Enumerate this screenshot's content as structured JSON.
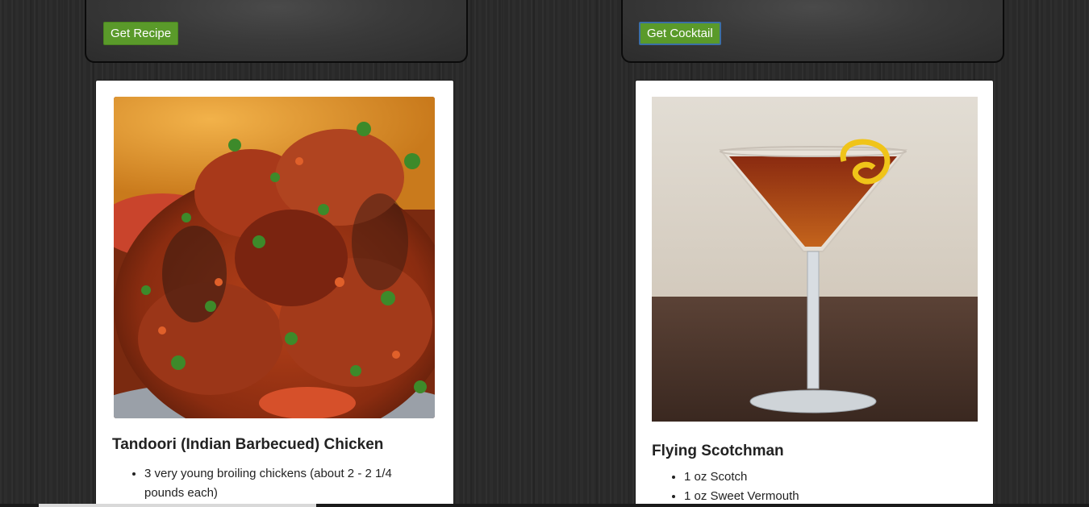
{
  "recipe_section": {
    "button_label": "Get Recipe",
    "card": {
      "image_alt": "tandoori-chicken-photo",
      "title": "Tandoori (Indian Barbecued) Chicken",
      "ingredients": [
        "3 very young broiling chickens (about 2 - 2 1/4 pounds each)"
      ]
    }
  },
  "cocktail_section": {
    "button_label": "Get Cocktail",
    "card": {
      "image_alt": "flying-scotchman-cocktail-photo",
      "title": "Flying Scotchman",
      "ingredients": [
        "1 oz Scotch",
        "1 oz Sweet Vermouth"
      ]
    }
  },
  "colors": {
    "button_green": "#5a9a2a",
    "button_focus_border": "#3b6fa6",
    "card_background": "#ffffff",
    "page_background": "#2b2b2b"
  }
}
